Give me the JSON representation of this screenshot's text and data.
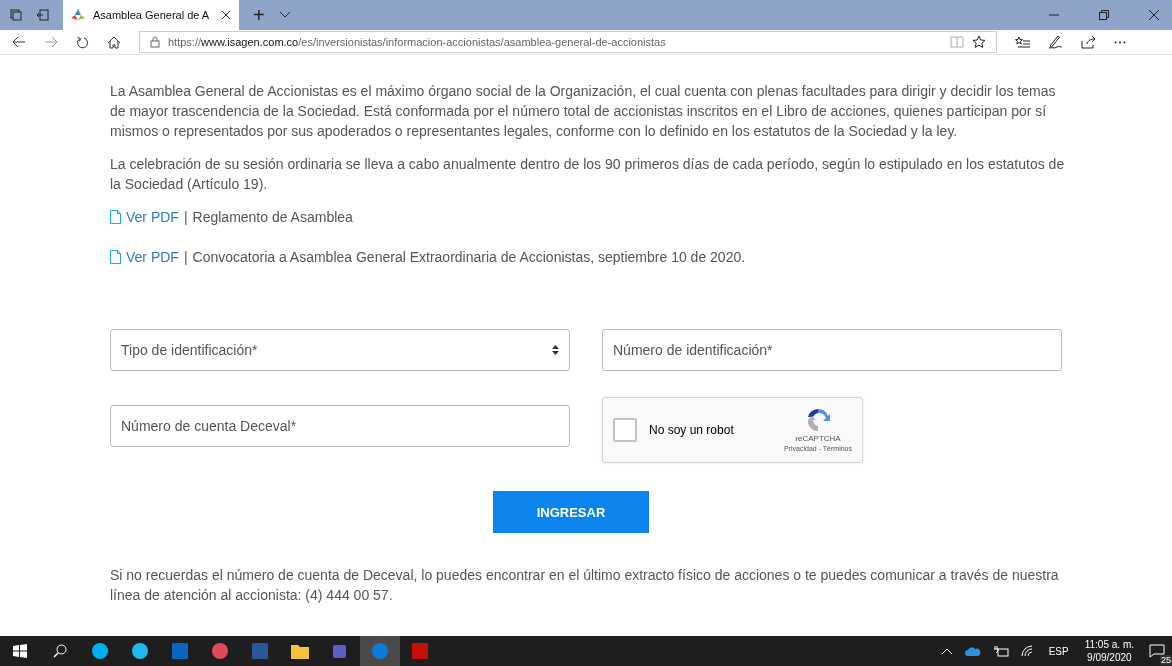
{
  "browser": {
    "tab_title": "Asamblea General de A",
    "new_tab": "+",
    "url": {
      "prefix": "https://",
      "domain": "www.isagen.com.co",
      "path": "/es/inversionistas/informacion-accionistas/asamblea-general-de-accionistas"
    }
  },
  "content": {
    "paragraphs": [
      "La Asamblea General de Accionistas es el máximo órgano social de la Organización, el cual cuenta con plenas facultades para dirigir y decidir los temas de mayor trascendencia de la Sociedad. Está conformada por el número total de accionistas inscritos en el Libro de acciones, quienes participan por sí mismos o representados por sus apoderados o representantes legales, conforme con lo definido en los estatutos de la Sociedad y la ley.",
      "La celebración de su sesión ordinaria se lleva a cabo anualmente dentro de los 90 primeros días de cada período, según lo estipulado en los estatutos de la Sociedad (Artículo 19)."
    ],
    "documents": [
      {
        "link": "Ver PDF",
        "separator": "|",
        "title": "Reglamento de Asamblea"
      },
      {
        "link": "Ver PDF",
        "separator": "|",
        "title": "Convocatoria a Asamblea General Extraordinaria de Accionistas, septiembre 10 de 2020."
      }
    ],
    "form": {
      "id_type": {
        "placeholder": "Tipo de identificación*"
      },
      "id_number": {
        "placeholder": "Número de identificación*"
      },
      "deceval_account": {
        "placeholder": "Número de cuenta Deceval*"
      },
      "captcha": {
        "label": "No soy un robot",
        "checked": false,
        "brand": "reCAPTCHA",
        "links": "Privacidad - Términos"
      },
      "submit": "INGRESAR"
    },
    "footer_note": "Si no recuerdas el número de cuenta de Deceval, lo puedes encontrar en el último extracto físico de acciones o te puedes comunicar a través de nuestra línea de atención al accionista: (4) 444 00 57."
  },
  "taskbar": {
    "apps": [
      {
        "kind": "skype",
        "selected": false
      },
      {
        "kind": "ie",
        "selected": false
      },
      {
        "kind": "outlook",
        "selected": false
      },
      {
        "kind": "paint",
        "selected": false
      },
      {
        "kind": "word",
        "selected": false
      },
      {
        "kind": "folder",
        "selected": false
      },
      {
        "kind": "teams",
        "selected": false
      },
      {
        "kind": "edge",
        "selected": true
      },
      {
        "kind": "acrobat",
        "selected": false
      }
    ],
    "language": "ESP",
    "time": "11:05 a. m.",
    "date": "9/09/2020",
    "notifications": "25"
  }
}
